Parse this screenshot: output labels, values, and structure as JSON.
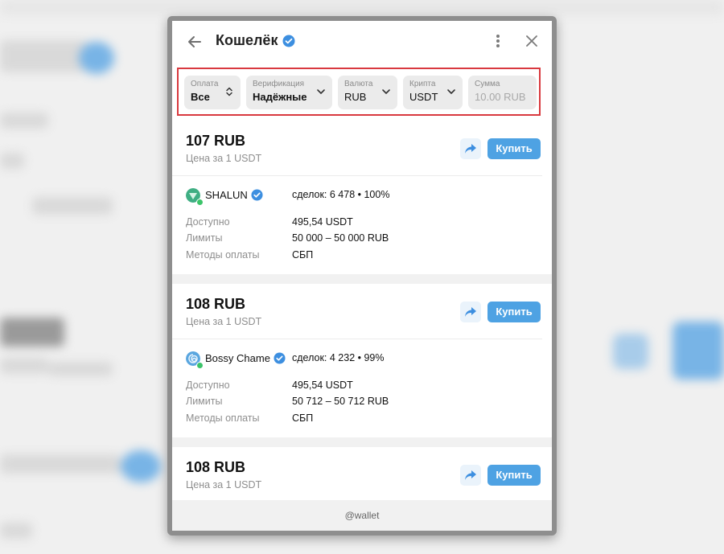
{
  "header": {
    "title": "Кошелёк"
  },
  "filters": [
    {
      "label": "Оплата",
      "value": "Все"
    },
    {
      "label": "Верификация",
      "value": "Надёжные"
    },
    {
      "label": "Валюта",
      "value": "RUB"
    },
    {
      "label": "Крипта",
      "value": "USDT"
    },
    {
      "label": "Сумма",
      "placeholder": "10.00 RUB"
    }
  ],
  "offers": [
    {
      "price": "107 RUB",
      "price_sub": "Цена за 1 USDT",
      "buy_label": "Купить",
      "merchant": "SHALUN",
      "deals": "сделок: 6 478 • 100%",
      "available_label": "Доступно",
      "available": "495,54 USDT",
      "limits_label": "Лимиты",
      "limits": "50 000 – 50 000 RUB",
      "methods_label": "Методы оплаты",
      "methods": "СБП"
    },
    {
      "price": "108 RUB",
      "price_sub": "Цена за 1 USDT",
      "buy_label": "Купить",
      "merchant": "Bossy Chame",
      "deals": "сделок: 4 232 • 99%",
      "available_label": "Доступно",
      "available": "495,54 USDT",
      "limits_label": "Лимиты",
      "limits": "50 712 – 50 712 RUB",
      "methods_label": "Методы оплаты",
      "methods": "СБП"
    },
    {
      "price": "108 RUB",
      "price_sub": "Цена за 1 USDT",
      "buy_label": "Купить"
    }
  ],
  "footer": {
    "text": "@wallet"
  },
  "colors": {
    "accent": "#4ea2e3",
    "highlight": "#d9393f",
    "online": "#3cc46a"
  }
}
